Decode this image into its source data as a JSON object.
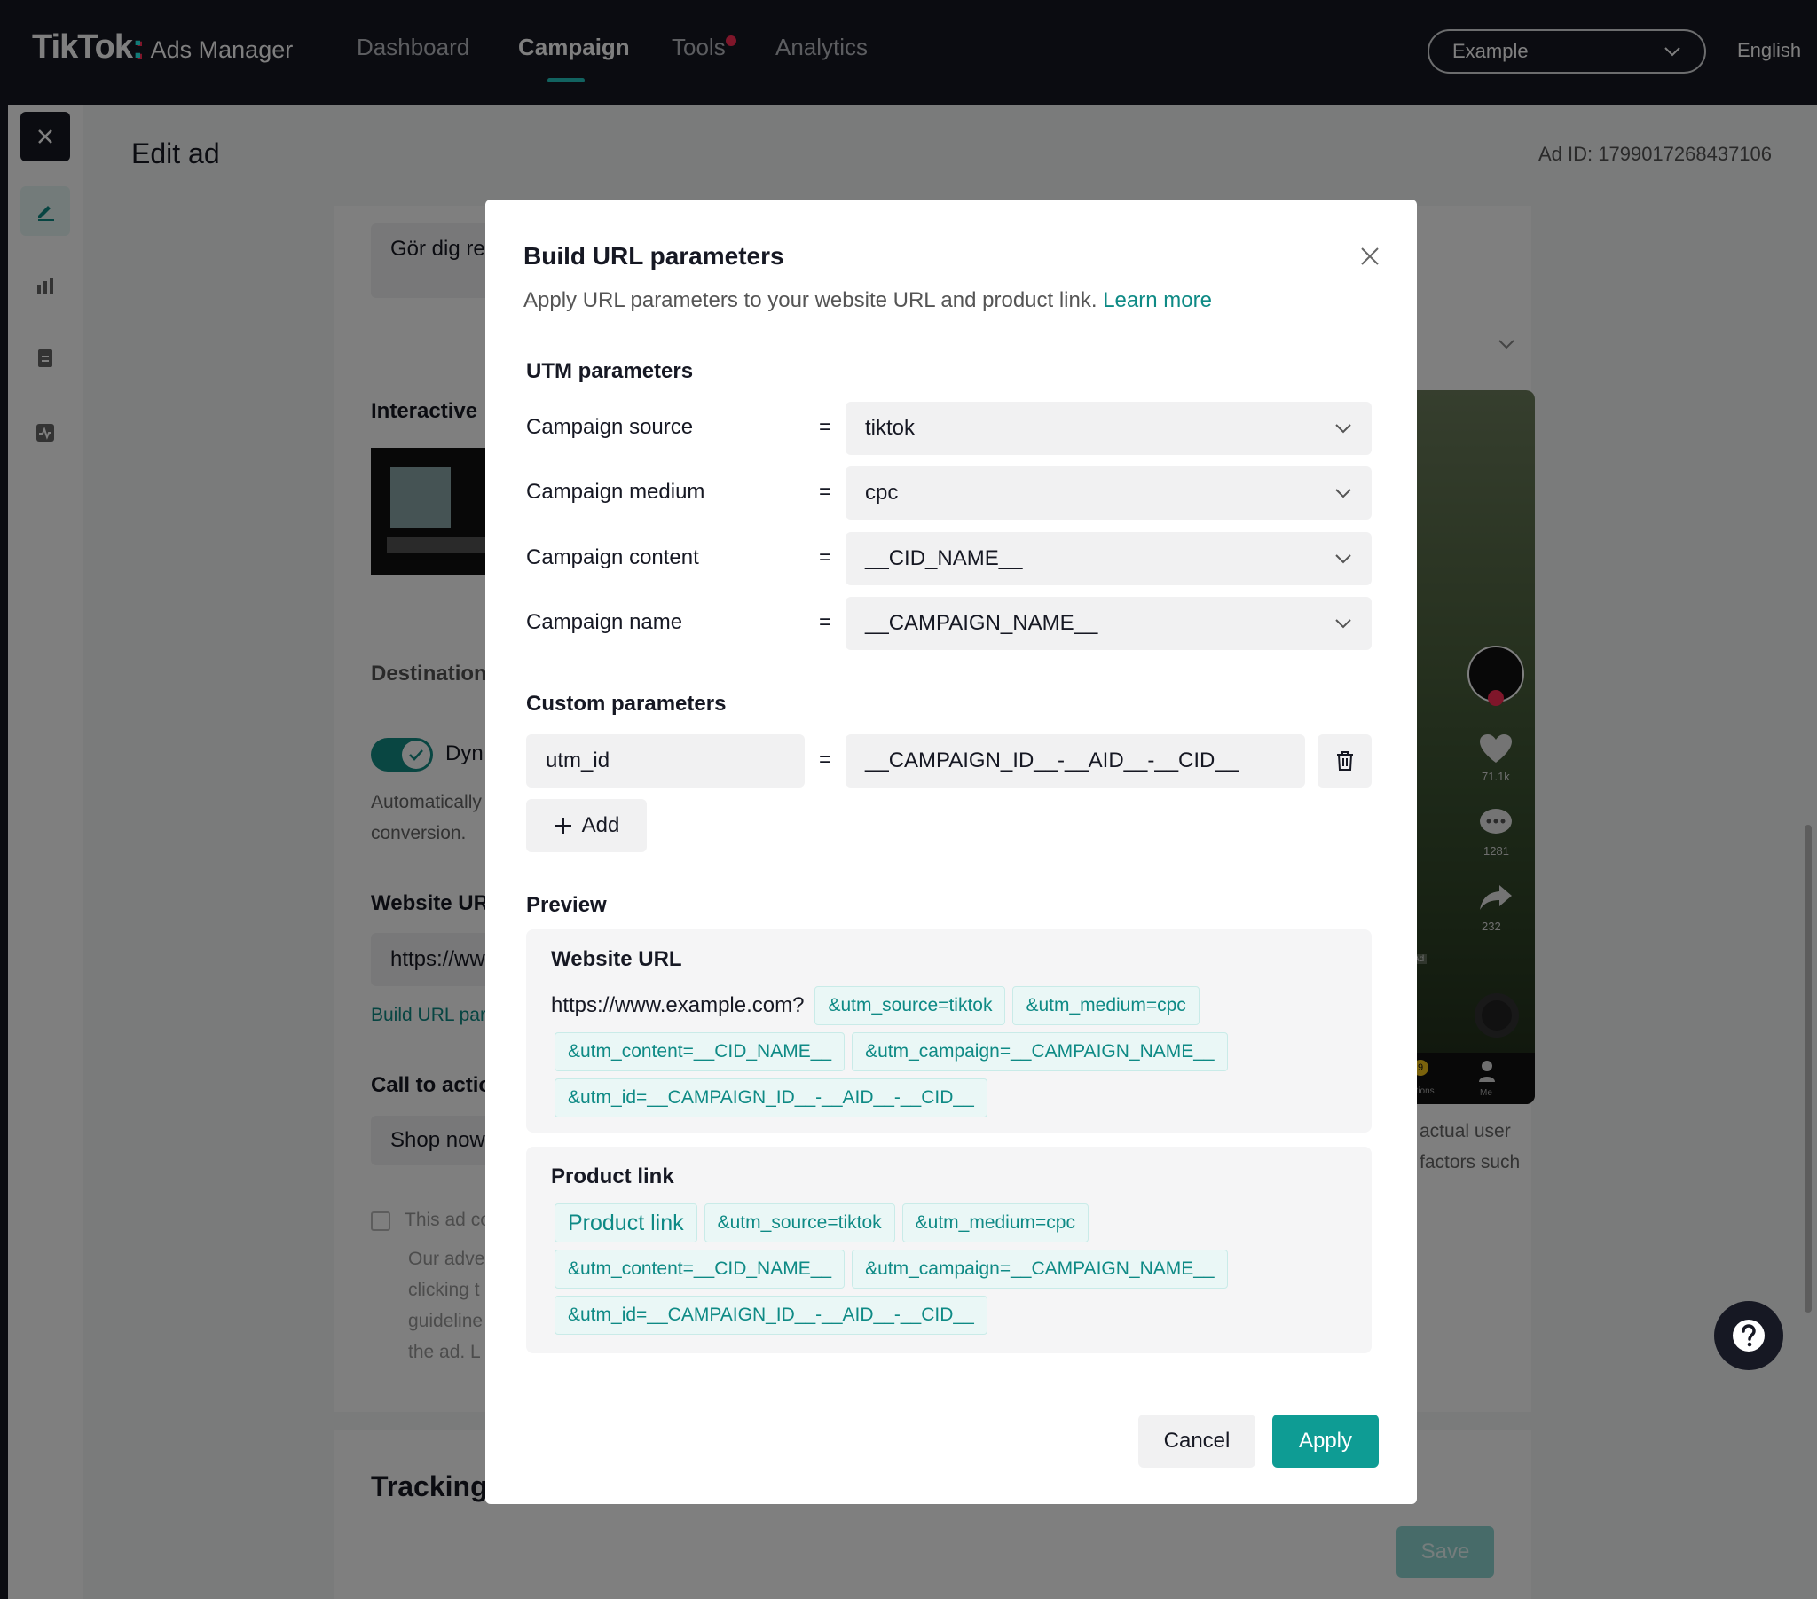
{
  "header": {
    "logo_main": "TikTok",
    "logo_colon": ":",
    "logo_sub": "Ads Manager",
    "nav": [
      {
        "label": "Dashboard"
      },
      {
        "label": "Campaign"
      },
      {
        "label": "Tools"
      },
      {
        "label": "Analytics"
      }
    ],
    "account_selected": "Example",
    "language": "English"
  },
  "page": {
    "title": "Edit ad",
    "ad_id": "Ad ID: 1799017268437106"
  },
  "background": {
    "text_field_value": "Gör dig re",
    "interactive_label": "Interactive",
    "destination_label": "Destination",
    "dynamic_toggle_label": "Dyn",
    "auto_text_1": "Automatically",
    "auto_text_2": "conversion.",
    "website_url_label": "Website UR",
    "website_url_value": "https://ww",
    "build_url_link": "Build URL par",
    "cta_label": "Call to actio",
    "cta_value": "Shop now",
    "checkbox_label": "This ad co",
    "policy_1": "Our adve",
    "policy_2": "clicking t",
    "policy_3": "guideline",
    "policy_4": "the ad. L",
    "tracking_label": "Tracking",
    "preview_note_1": "actual user",
    "preview_note_2": "factors such",
    "phone_likes": "71.1k",
    "phone_comments": "1281",
    "phone_shares": "232",
    "phone_ad_tag": "Ad",
    "phone_tab_notifications": "ations",
    "phone_tab_me": "Me",
    "phone_badge": "9",
    "save_label": "Save"
  },
  "modal": {
    "title": "Build URL parameters",
    "description": "Apply URL parameters to your website URL and product link.",
    "learn_more": "Learn more",
    "utm_section": "UTM parameters",
    "utm_rows": [
      {
        "label": "Campaign source",
        "value": "tiktok"
      },
      {
        "label": "Campaign medium",
        "value": "cpc"
      },
      {
        "label": "Campaign content",
        "value": "__CID_NAME__"
      },
      {
        "label": "Campaign name",
        "value": "__CAMPAIGN_NAME__"
      }
    ],
    "equals": "=",
    "custom_section": "Custom parameters",
    "custom_params": [
      {
        "key": "utm_id",
        "value": "__CAMPAIGN_ID__-__AID__-__CID__"
      }
    ],
    "add_label": "Add",
    "preview_section": "Preview",
    "website_preview": {
      "title": "Website URL",
      "base": "https://www.example.com?",
      "chips": [
        "&utm_source=tiktok",
        "&utm_medium=cpc",
        "&utm_content=__CID_NAME__",
        "&utm_campaign=__CAMPAIGN_NAME__",
        "&utm_id=__CAMPAIGN_ID__-__AID__-__CID__"
      ]
    },
    "product_preview": {
      "title": "Product link",
      "base_chip": "Product link",
      "chips": [
        "&utm_source=tiktok",
        "&utm_medium=cpc",
        "&utm_content=__CID_NAME__",
        "&utm_campaign=__CAMPAIGN_NAME__",
        "&utm_id=__CAMPAIGN_ID__-__AID__-__CID__"
      ]
    },
    "cancel_label": "Cancel",
    "apply_label": "Apply"
  },
  "colors": {
    "nav_bg": "#161823",
    "accent": "#0e9c94",
    "link": "#0e8a85",
    "field_bg": "#f1f1f2"
  }
}
